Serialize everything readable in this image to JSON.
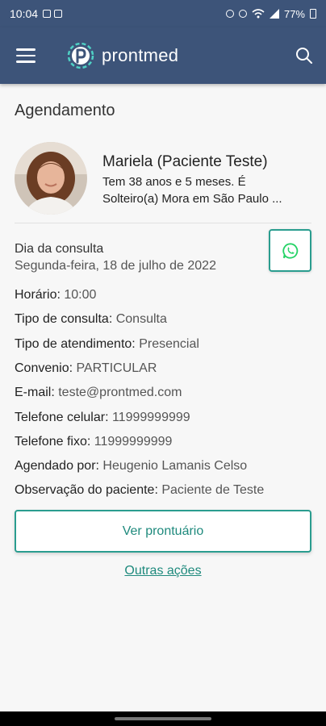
{
  "status": {
    "time": "10:04",
    "battery": "77%"
  },
  "app": {
    "logo_text": "prontmed"
  },
  "page": {
    "title": "Agendamento"
  },
  "patient": {
    "name": "Mariela (Paciente Teste)",
    "age_line": "Tem 38 anos e 5 meses. É",
    "info_line": "Solteiro(a) Mora em São Paulo ..."
  },
  "appointment": {
    "day_label": "Dia da consulta",
    "day_value": "Segunda-feira, 18 de julho de 2022",
    "fields": [
      {
        "label": "Horário:",
        "value": "10:00"
      },
      {
        "label": "Tipo de consulta:",
        "value": "Consulta"
      },
      {
        "label": "Tipo de atendimento:",
        "value": "Presencial"
      },
      {
        "label": "Convenio:",
        "value": "PARTICULAR"
      },
      {
        "label": "E-mail:",
        "value": "teste@prontmed.com"
      },
      {
        "label": "Telefone celular:",
        "value": "11999999999"
      },
      {
        "label": "Telefone fixo:",
        "value": "11999999999"
      },
      {
        "label": "Agendado por:",
        "value": " Heugenio Lamanis Celso"
      },
      {
        "label": "Observação do paciente:",
        "value": "Paciente de Teste"
      }
    ]
  },
  "actions": {
    "view_record": "Ver prontuário",
    "other_actions": "Outras ações"
  },
  "colors": {
    "appbar": "#3d5479",
    "accent": "#2a9d8f",
    "whatsapp": "#25d366"
  },
  "icons": {
    "menu": "hamburger-menu-icon",
    "search": "search-icon",
    "whatsapp": "whatsapp-icon"
  }
}
